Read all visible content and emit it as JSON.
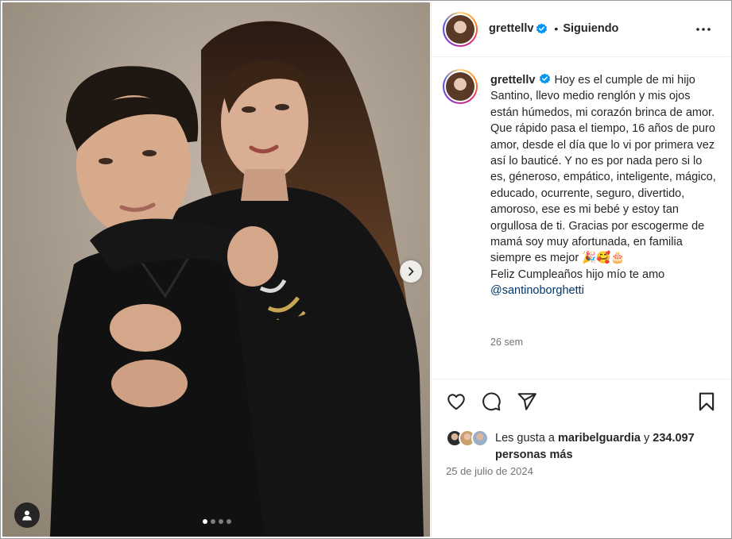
{
  "post": {
    "username": "grettellv",
    "separator": "•",
    "follow_status": "Siguiendo",
    "caption_text": "Hoy es el cumple de mi hijo Santino, llevo medio renglón y mis ojos están húmedos, mi corazón brinca de amor. Que rápido pasa el tiempo, 16 años de puro amor, desde el día que lo vi por primera vez así lo bauticé. Y no es por nada pero si lo es, géneroso, empático, inteligente, mágico, educado, ocurrente, seguro, divertido, amoroso, ese es mi bebé y estoy tan orgullosa de ti. Gracias por escogerme de mamá soy muy afortunada, en familia siempre es mejor 🎉🥰🎂\nFeliz Cumpleaños hijo mío te amo\n",
    "mention": "@santinoborghetti",
    "time_ago": "26 sem",
    "likes_prefix": "Les gusta a ",
    "likes_user": "maribelguardia",
    "likes_middle": " y ",
    "likes_count": "234.097",
    "likes_suffix": "personas más",
    "date": "25 de julio de 2024",
    "carousel": {
      "total": 4,
      "active": 0
    }
  },
  "icons": {
    "verified": "verified-badge-icon",
    "more": "more-options-icon",
    "like": "heart-icon",
    "comment": "comment-icon",
    "share": "send-icon",
    "save": "bookmark-icon",
    "next": "chevron-right-icon",
    "tags": "user-tag-icon"
  },
  "colors": {
    "verified": "#0095f6",
    "link": "#00376b",
    "muted": "#737373",
    "text": "#262626"
  }
}
